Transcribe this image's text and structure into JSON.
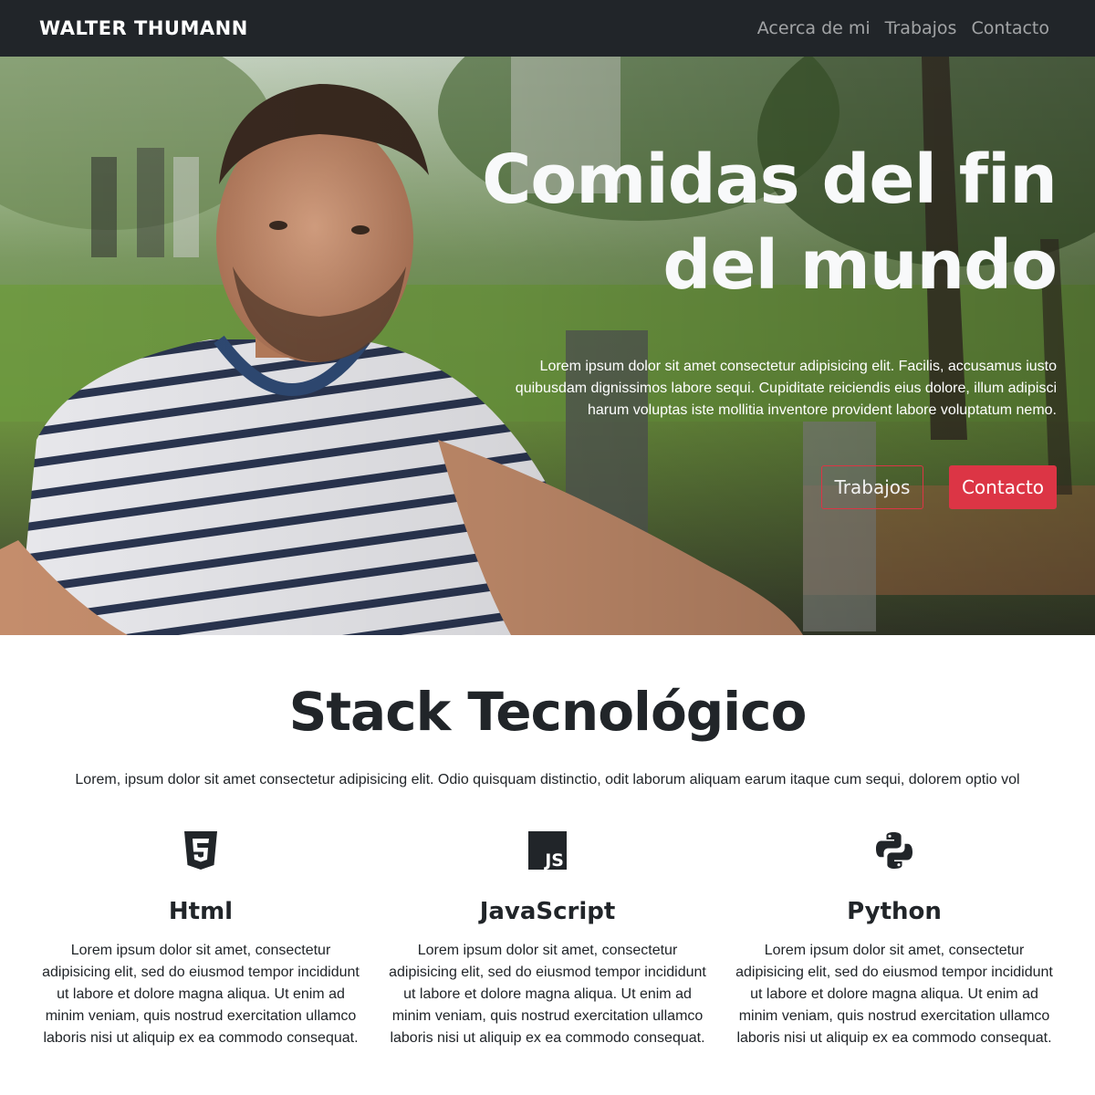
{
  "navbar": {
    "brand": "WALTER THUMANN",
    "links": [
      "Acerca de mi",
      "Trabajos",
      "Contacto"
    ]
  },
  "hero": {
    "title_line1": "Comidas del fin",
    "title_line2": "del mundo",
    "text": "Lorem ipsum dolor sit amet consectetur adipisicing elit. Facilis, accusamus iusto quibusdam dignissimos labore sequi. Cupiditate reiciendis eius dolore, illum adipisci harum voluptas iste mollitia inventore provident labore voluptatum nemo.",
    "button_primary": "Trabajos",
    "button_secondary": "Contacto"
  },
  "stack": {
    "title": "Stack Tecnológico",
    "lead": "Lorem, ipsum dolor sit amet consectetur adipisicing elit. Odio quisquam distinctio, odit laborum aliquam earum itaque cum sequi, dolorem optio vol",
    "items": [
      {
        "icon": "html5-icon",
        "title": "Html",
        "text": "Lorem ipsum dolor sit amet, consectetur adipisicing elit, sed do eiusmod tempor incididunt ut labore et dolore magna aliqua. Ut enim ad minim veniam, quis nostrud exercitation ullamco laboris nisi ut aliquip ex ea commodo consequat."
      },
      {
        "icon": "javascript-icon",
        "title": "JavaScript",
        "text": "Lorem ipsum dolor sit amet, consectetur adipisicing elit, sed do eiusmod tempor incididunt ut labore et dolore magna aliqua. Ut enim ad minim veniam, quis nostrud exercitation ullamco laboris nisi ut aliquip ex ea commodo consequat."
      },
      {
        "icon": "python-icon",
        "title": "Python",
        "text": "Lorem ipsum dolor sit amet, consectetur adipisicing elit, sed do eiusmod tempor incididunt ut labore et dolore magna aliqua. Ut enim ad minim veniam, quis nostrud exercitation ullamco laboris nisi ut aliquip ex ea commodo consequat."
      }
    ]
  },
  "colors": {
    "navbar_bg": "#212529",
    "accent_red": "#dc3545",
    "text_dark": "#212529"
  }
}
